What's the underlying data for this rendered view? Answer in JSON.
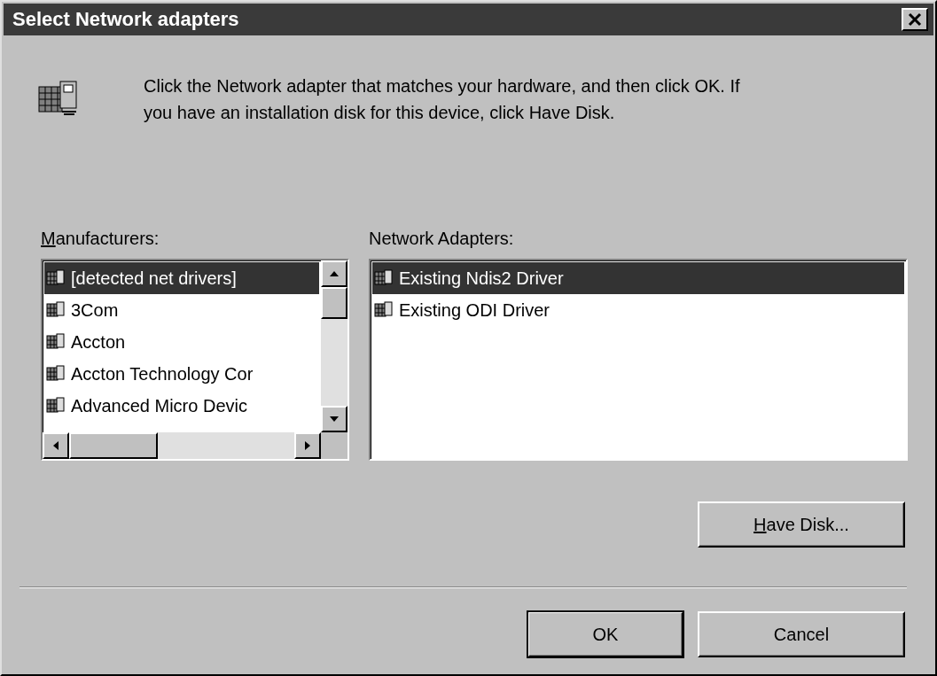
{
  "window": {
    "title": "Select Network adapters"
  },
  "instructions": "Click the Network adapter that matches your hardware, and then click OK. If you have an installation disk for this device, click Have Disk.",
  "manufacturers": {
    "label": {
      "access_key": "M",
      "rest": "anufacturers:"
    },
    "items": [
      {
        "name": "[detected net drivers]",
        "selected": true
      },
      {
        "name": "3Com",
        "selected": false
      },
      {
        "name": "Accton",
        "selected": false
      },
      {
        "name": "Accton Technology Cor",
        "selected": false
      },
      {
        "name": "Advanced Micro Devic",
        "selected": false
      }
    ]
  },
  "adapters": {
    "label": "Network Adapters:",
    "items": [
      {
        "name": "Existing Ndis2 Driver",
        "selected": true
      },
      {
        "name": "Existing ODI Driver",
        "selected": false
      }
    ]
  },
  "have_disk_button": {
    "access_key": "H",
    "rest": "ave Disk..."
  },
  "buttons": [
    {
      "label": "OK",
      "default": true
    },
    {
      "label": "Cancel",
      "default": false
    }
  ]
}
